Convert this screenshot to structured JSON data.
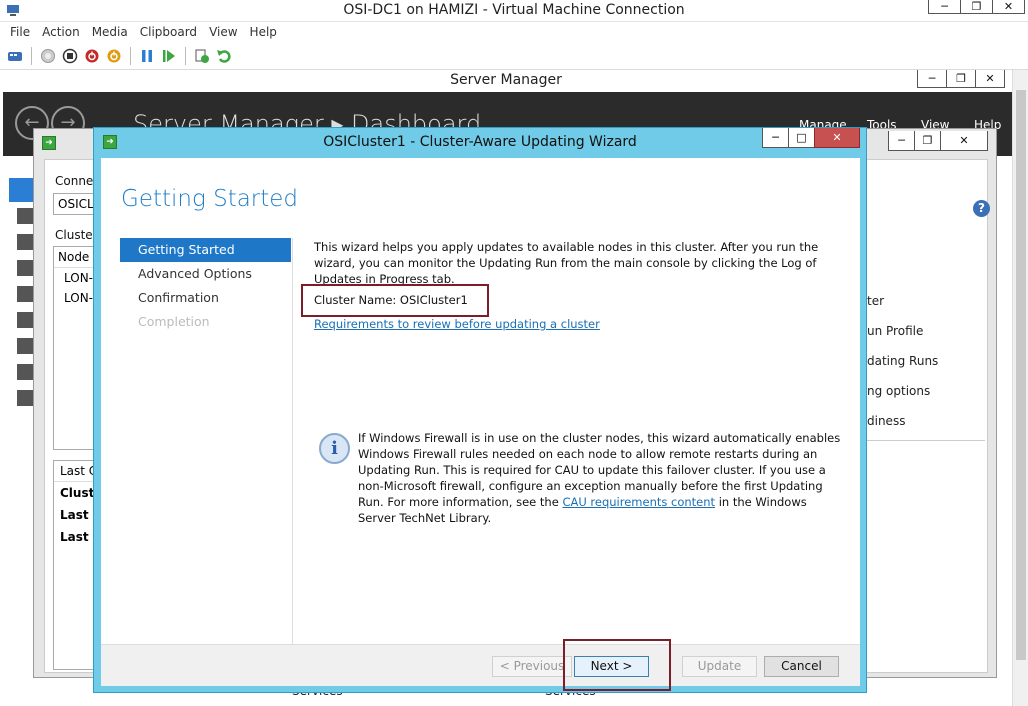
{
  "vm": {
    "title": "OSI-DC1 on HAMIZI - Virtual Machine Connection",
    "menu": [
      "File",
      "Action",
      "Media",
      "Clipboard",
      "View",
      "Help"
    ]
  },
  "server_manager": {
    "title": "Server Manager",
    "breadcrumb": "Server Manager ▸ Dashboard",
    "menus": [
      "Manage",
      "Tools",
      "View",
      "Help"
    ],
    "bottom_labels": [
      "Services",
      "Services"
    ]
  },
  "cau_window": {
    "connect_label": "Connect",
    "connect_value": "OSICLU",
    "cluster_label": "Cluster",
    "node_header": "Node n",
    "nodes": [
      "LON-",
      "LON-"
    ],
    "last_header": "Last C",
    "last_rows": [
      "Cluste",
      "Last U",
      "Last u"
    ],
    "actions": [
      "ter",
      "un Profile",
      "dating Runs",
      "ng options",
      "diness"
    ]
  },
  "wizard": {
    "title": "OSICluster1 - Cluster-Aware Updating Wizard",
    "heading": "Getting Started",
    "steps": [
      "Getting Started",
      "Advanced Options",
      "Confirmation",
      "Completion"
    ],
    "intro": "This wizard helps you apply updates to available nodes in this cluster. After you run the wizard, you can monitor the Updating Run from the main console by clicking the Log of Updates in Progress tab.",
    "cluster_name": "Cluster Name: OSICluster1",
    "requirements_link": "Requirements to review before updating a cluster",
    "info_before": "If Windows Firewall is in use on the cluster nodes, this wizard automatically enables Windows Firewall rules needed on each node to allow remote restarts during an Updating Run. This is required for CAU to update this failover cluster. If you use a non-Microsoft firewall, configure an exception manually before the first Updating Run. For more information, see the ",
    "info_link": "CAU requirements content",
    "info_after": " in the Windows Server TechNet Library.",
    "buttons": {
      "previous": "< Previous",
      "next": "Next >",
      "update": "Update",
      "cancel": "Cancel"
    }
  }
}
